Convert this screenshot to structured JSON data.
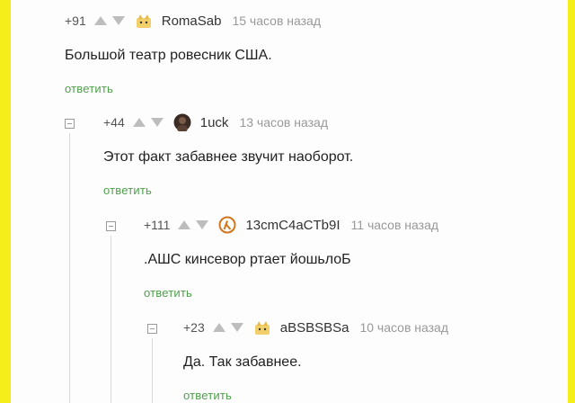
{
  "comments": [
    {
      "rating": "+91",
      "author": "RomaSab",
      "time": "15 часов назад",
      "text": "Большой театр ровесник США.",
      "reply": "ответить",
      "avatar": "cat-avatar-icon"
    },
    {
      "rating": "+44",
      "author": "1uck",
      "time": "13 часов назад",
      "text": "Этот факт забавнее звучит наоборот.",
      "reply": "ответить",
      "avatar": "photo-avatar-icon"
    },
    {
      "rating": "+111",
      "author": "13cmC4aCTb9I",
      "time": "11 часов назад",
      "text": ".АШС кинсевор ртает йошьлоБ",
      "reply": "ответить",
      "avatar": "lambda-avatar-icon"
    },
    {
      "rating": "+23",
      "author": "aBSBSBSa",
      "time": "10 часов назад",
      "text": "Да. Так забавнее.",
      "reply": "ответить",
      "avatar": "cat-avatar-icon"
    }
  ],
  "colors": {
    "frame": "#f6ee1a",
    "reply_link": "#4ea04a",
    "meta_text": "#999999",
    "main_text": "#222222"
  }
}
